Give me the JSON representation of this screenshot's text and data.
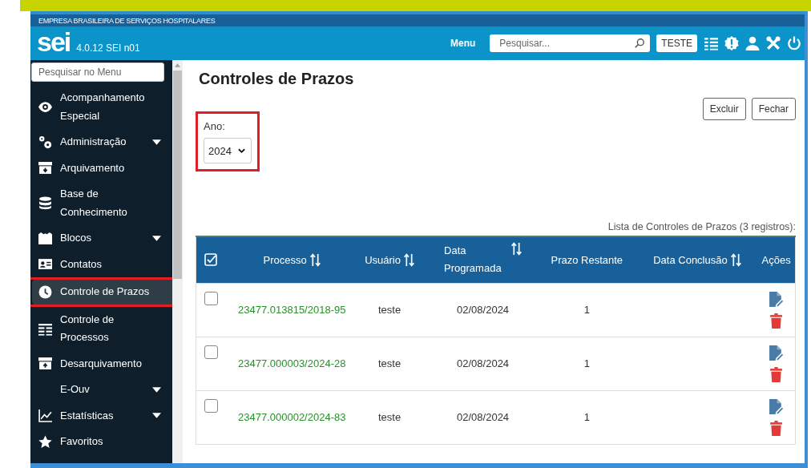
{
  "header": {
    "organization": "EMPRESA BRASILEIRA DE SERVIÇOS HOSPITALARES",
    "logo": "sei",
    "version": "4.0.12 SEI n01",
    "menu_label": "Menu",
    "search": {
      "placeholder": "Pesquisar..."
    },
    "unit": "TESTE"
  },
  "sidebar": {
    "search": {
      "placeholder": "Pesquisar no Menu"
    },
    "items": [
      {
        "label": "Acompanhamento Especial",
        "has_submenu": false,
        "selected": false,
        "highlighted": false
      },
      {
        "label": "Administração",
        "has_submenu": true,
        "selected": false,
        "highlighted": false
      },
      {
        "label": "Arquivamento",
        "has_submenu": false,
        "selected": false,
        "highlighted": false
      },
      {
        "label": "Base de Conhecimento",
        "has_submenu": false,
        "selected": false,
        "highlighted": false
      },
      {
        "label": "Blocos",
        "has_submenu": true,
        "selected": false,
        "highlighted": false
      },
      {
        "label": "Contatos",
        "has_submenu": false,
        "selected": false,
        "highlighted": false
      },
      {
        "label": "Controle de Prazos",
        "has_submenu": false,
        "selected": true,
        "highlighted": true
      },
      {
        "label": "Controle de Processos",
        "has_submenu": false,
        "selected": false,
        "highlighted": false
      },
      {
        "label": "Desarquivamento",
        "has_submenu": false,
        "selected": false,
        "highlighted": false
      },
      {
        "label": "E-Ouv",
        "has_submenu": true,
        "selected": false,
        "highlighted": false
      },
      {
        "label": "Estatísticas",
        "has_submenu": true,
        "selected": false,
        "highlighted": false
      },
      {
        "label": "Favoritos",
        "has_submenu": false,
        "selected": false,
        "highlighted": false
      }
    ]
  },
  "page": {
    "title": "Controles de Prazos",
    "buttons": [
      "Excluir",
      "Fechar"
    ],
    "year_filter": {
      "label": "Ano:",
      "value": "2024",
      "highlighted": true
    },
    "table": {
      "caption": "Lista de Controles de Prazos (3 registros):",
      "all_checked": false,
      "columns": [
        {
          "label": "Processo",
          "sortable": true
        },
        {
          "label": "Usuário",
          "sortable": true
        },
        {
          "label": "Data Programada",
          "sortable": true
        },
        {
          "label": "Prazo Restante",
          "sortable": false
        },
        {
          "label": "Data Conclusão",
          "sortable": true
        },
        {
          "label": "Ações",
          "sortable": false
        }
      ],
      "rows": [
        {
          "checked": false,
          "processo": "23477.013815/2018-95",
          "usuario": "teste",
          "data_programada": "02/08/2024",
          "prazo_restante": "1",
          "data_conclusao": ""
        },
        {
          "checked": false,
          "processo": "23477.000003/2024-28",
          "usuario": "teste",
          "data_programada": "02/08/2024",
          "prazo_restante": "1",
          "data_conclusao": ""
        },
        {
          "checked": false,
          "processo": "23477.000002/2024-83",
          "usuario": "teste",
          "data_programada": "02/08/2024",
          "prazo_restante": "1",
          "data_conclusao": ""
        }
      ]
    }
  }
}
